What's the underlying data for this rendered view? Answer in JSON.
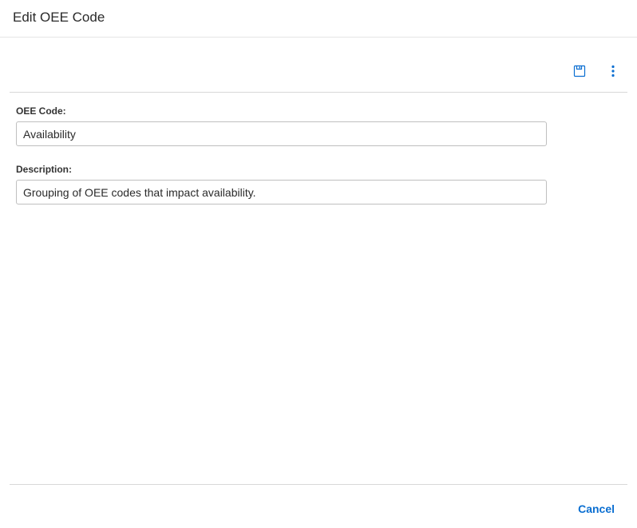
{
  "header": {
    "title": "Edit OEE Code"
  },
  "toolbar": {
    "save_icon": "save-icon",
    "menu_icon": "kebab-menu-icon"
  },
  "form": {
    "oee_code": {
      "label": "OEE Code:",
      "value": "Availability"
    },
    "description": {
      "label": "Description:",
      "value": "Grouping of OEE codes that impact availability."
    }
  },
  "footer": {
    "cancel_label": "Cancel"
  },
  "colors": {
    "accent": "#0a6ed1"
  }
}
